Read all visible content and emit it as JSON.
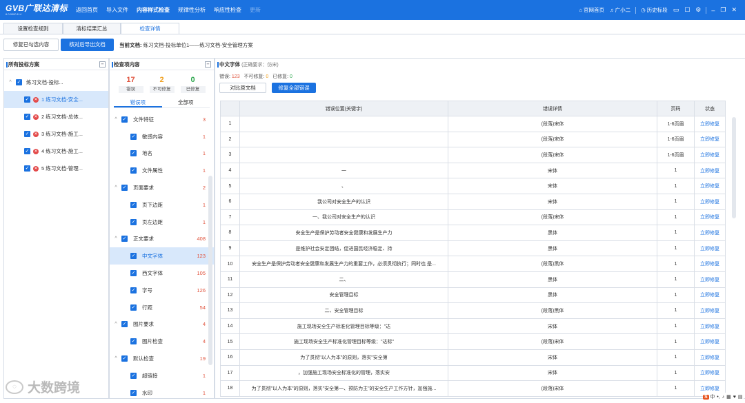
{
  "app": {
    "brand": "GVB广联达清标",
    "version": "6.0.9000.114"
  },
  "menu": [
    "返回首页",
    "导入文件",
    "内容样式检查",
    "规律性分析",
    "响应性检查",
    "更新"
  ],
  "topright": {
    "official": "官网首页",
    "user": "广小二",
    "history": "历史标段"
  },
  "tabs": [
    "设置检查规则",
    "清标结果汇总",
    "检查详情"
  ],
  "actions": {
    "repair_selected": "修复已勾选内容",
    "export": "核对后导出文档"
  },
  "current_doc": {
    "label": "当前文档:",
    "value": "练习文档-投标单位1——练习文档-安全管理方案"
  },
  "left": {
    "title": "所有投标方案",
    "root": "练习文档-投标...",
    "docs": [
      "1 练习文档-安全...",
      "2 练习文档-总体...",
      "3 练习文档-施工...",
      "4 练习文档-施工...",
      "5 练习文档-管理..."
    ]
  },
  "middle": {
    "title": "检查项内容",
    "stats": [
      {
        "value": "17",
        "label": "错误",
        "color": "#e0533d"
      },
      {
        "value": "2",
        "label": "不可修复",
        "color": "#f0a020"
      },
      {
        "value": "0",
        "label": "已修复",
        "color": "#2fa84f"
      }
    ],
    "subtabs": [
      "错误项",
      "全部项"
    ],
    "items": [
      {
        "label": "文件特征",
        "count": "3",
        "level": 0
      },
      {
        "label": "敏感内容",
        "count": "1",
        "level": 1
      },
      {
        "label": "地名",
        "count": "1",
        "level": 1
      },
      {
        "label": "文件属性",
        "count": "1",
        "level": 1
      },
      {
        "label": "页面要求",
        "count": "2",
        "level": 0
      },
      {
        "label": "页下边距",
        "count": "1",
        "level": 1
      },
      {
        "label": "页左边距",
        "count": "1",
        "level": 1
      },
      {
        "label": "正文要求",
        "count": "408",
        "level": 0
      },
      {
        "label": "中文字体",
        "count": "123",
        "level": 1
      },
      {
        "label": "西文字体",
        "count": "105",
        "level": 1
      },
      {
        "label": "字号",
        "count": "126",
        "level": 1
      },
      {
        "label": "行距",
        "count": "54",
        "level": 1
      },
      {
        "label": "图片要求",
        "count": "4",
        "level": 0
      },
      {
        "label": "图片检查",
        "count": "4",
        "level": 1
      },
      {
        "label": "默认检查",
        "count": "19",
        "level": 0
      },
      {
        "label": "超链接",
        "count": "1",
        "level": 1
      },
      {
        "label": "水印",
        "count": "1",
        "level": 1
      }
    ]
  },
  "right": {
    "title": "中文字体",
    "requirement": "(正确要求：仿宋)",
    "summary": {
      "err_label": "错误:",
      "err": "123",
      "unfix_label": "不可修复:",
      "unfix": "0",
      "fixed_label": "已修复:",
      "fixed": "0"
    },
    "buttons": {
      "compare": "对比原文档",
      "fix_all": "修复全部错误"
    },
    "columns": [
      "",
      "错误位置(关键字)",
      "错误详情",
      "页码",
      "状态"
    ],
    "rows": [
      [
        "1",
        "",
        "(段落)宋体",
        "1-6页眉",
        "立即修复"
      ],
      [
        "2",
        "",
        "(段落)宋体",
        "1-6页眉",
        "立即修复"
      ],
      [
        "3",
        "",
        "(段落)宋体",
        "1-6页眉",
        "立即修复"
      ],
      [
        "4",
        "一",
        "宋体",
        "1",
        "立即修复"
      ],
      [
        "5",
        "、",
        "宋体",
        "1",
        "立即修复"
      ],
      [
        "6",
        "我公司对安全生产的认识",
        "宋体",
        "1",
        "立即修复"
      ],
      [
        "7",
        "一、我公司对安全生产的认识",
        "(段落)宋体",
        "1",
        "立即修复"
      ],
      [
        "8",
        "安全生产是保护劳动者安全健康和发展生产力",
        "黑体",
        "1",
        "立即修复"
      ],
      [
        "9",
        "是维护社会安定团结，促进国民经济稳定、持",
        "黑体",
        "1",
        "立即修复"
      ],
      [
        "10",
        "安全生产是保护劳动者安全健康和发展生产力的重要工作，必须贯彻执行；同时也 是...",
        "(段落)黑体",
        "1",
        "立即修复"
      ],
      [
        "11",
        "二、",
        "黑体",
        "1",
        "立即修复"
      ],
      [
        "12",
        "安全管理目标",
        "黑体",
        "1",
        "立即修复"
      ],
      [
        "13",
        "二、安全管理目标",
        "(段落)黑体",
        "1",
        "立即修复"
      ],
      [
        "14",
        "施工现场安全生产标准化管理目标等级：\"达",
        "宋体",
        "1",
        "立即修复"
      ],
      [
        "15",
        "施工现场安全生产标准化管理目标等级：\"达标\"",
        "(段落)宋体",
        "1",
        "立即修复"
      ],
      [
        "16",
        "为了贯彻\"以人为本\"的原则，落实\"安全第",
        "宋体",
        "1",
        "立即修复"
      ],
      [
        "17",
        "，加强施工现场安全标准化的管理，落实安",
        "宋体",
        "1",
        "立即修复"
      ],
      [
        "18",
        "为了贯彻\"以人为本\"的原则，落实\"安全第一、预防为主\"的安全生产工作方针，加强施...",
        "(段落)宋体",
        "1",
        "立即修复"
      ]
    ]
  },
  "watermark": "大数跨境",
  "ime": {
    "logo": "S",
    "lang": "中"
  }
}
